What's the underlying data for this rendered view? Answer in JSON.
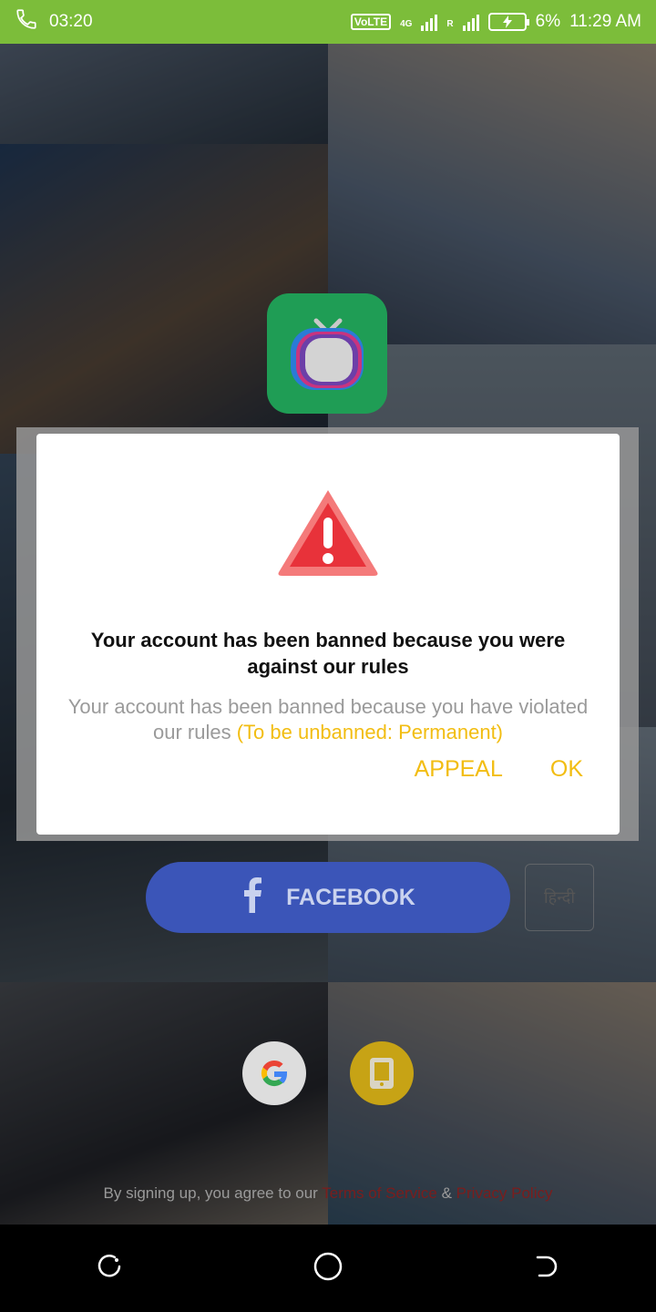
{
  "status_bar": {
    "call_time": "03:20",
    "network_label": "VoLTE",
    "network_type": "4G",
    "roaming": "R",
    "battery": "6%",
    "clock": "11:29 AM",
    "bg_color": "#7cbd3a"
  },
  "dialog": {
    "icon": "warning-triangle-icon",
    "title": "Your account has been banned because you were against our rules",
    "message": "Your account has been banned because you have violated our rules",
    "message_highlight": "(To be unbanned: Permanent)",
    "appeal_label": "APPEAL",
    "ok_label": "OK",
    "accent_color": "#f2bd12"
  },
  "login": {
    "facebook_label": "FACEBOOK",
    "language_label": "हिन्दी",
    "terms_prefix": "By signing up, you agree to our",
    "terms_link": "Terms of Service",
    "terms_and": "&",
    "privacy_link": "Privacy Policy",
    "facebook_color": "#3b55b8"
  },
  "nav_bar": {
    "items": [
      "recents-icon",
      "home-icon",
      "back-icon"
    ]
  }
}
